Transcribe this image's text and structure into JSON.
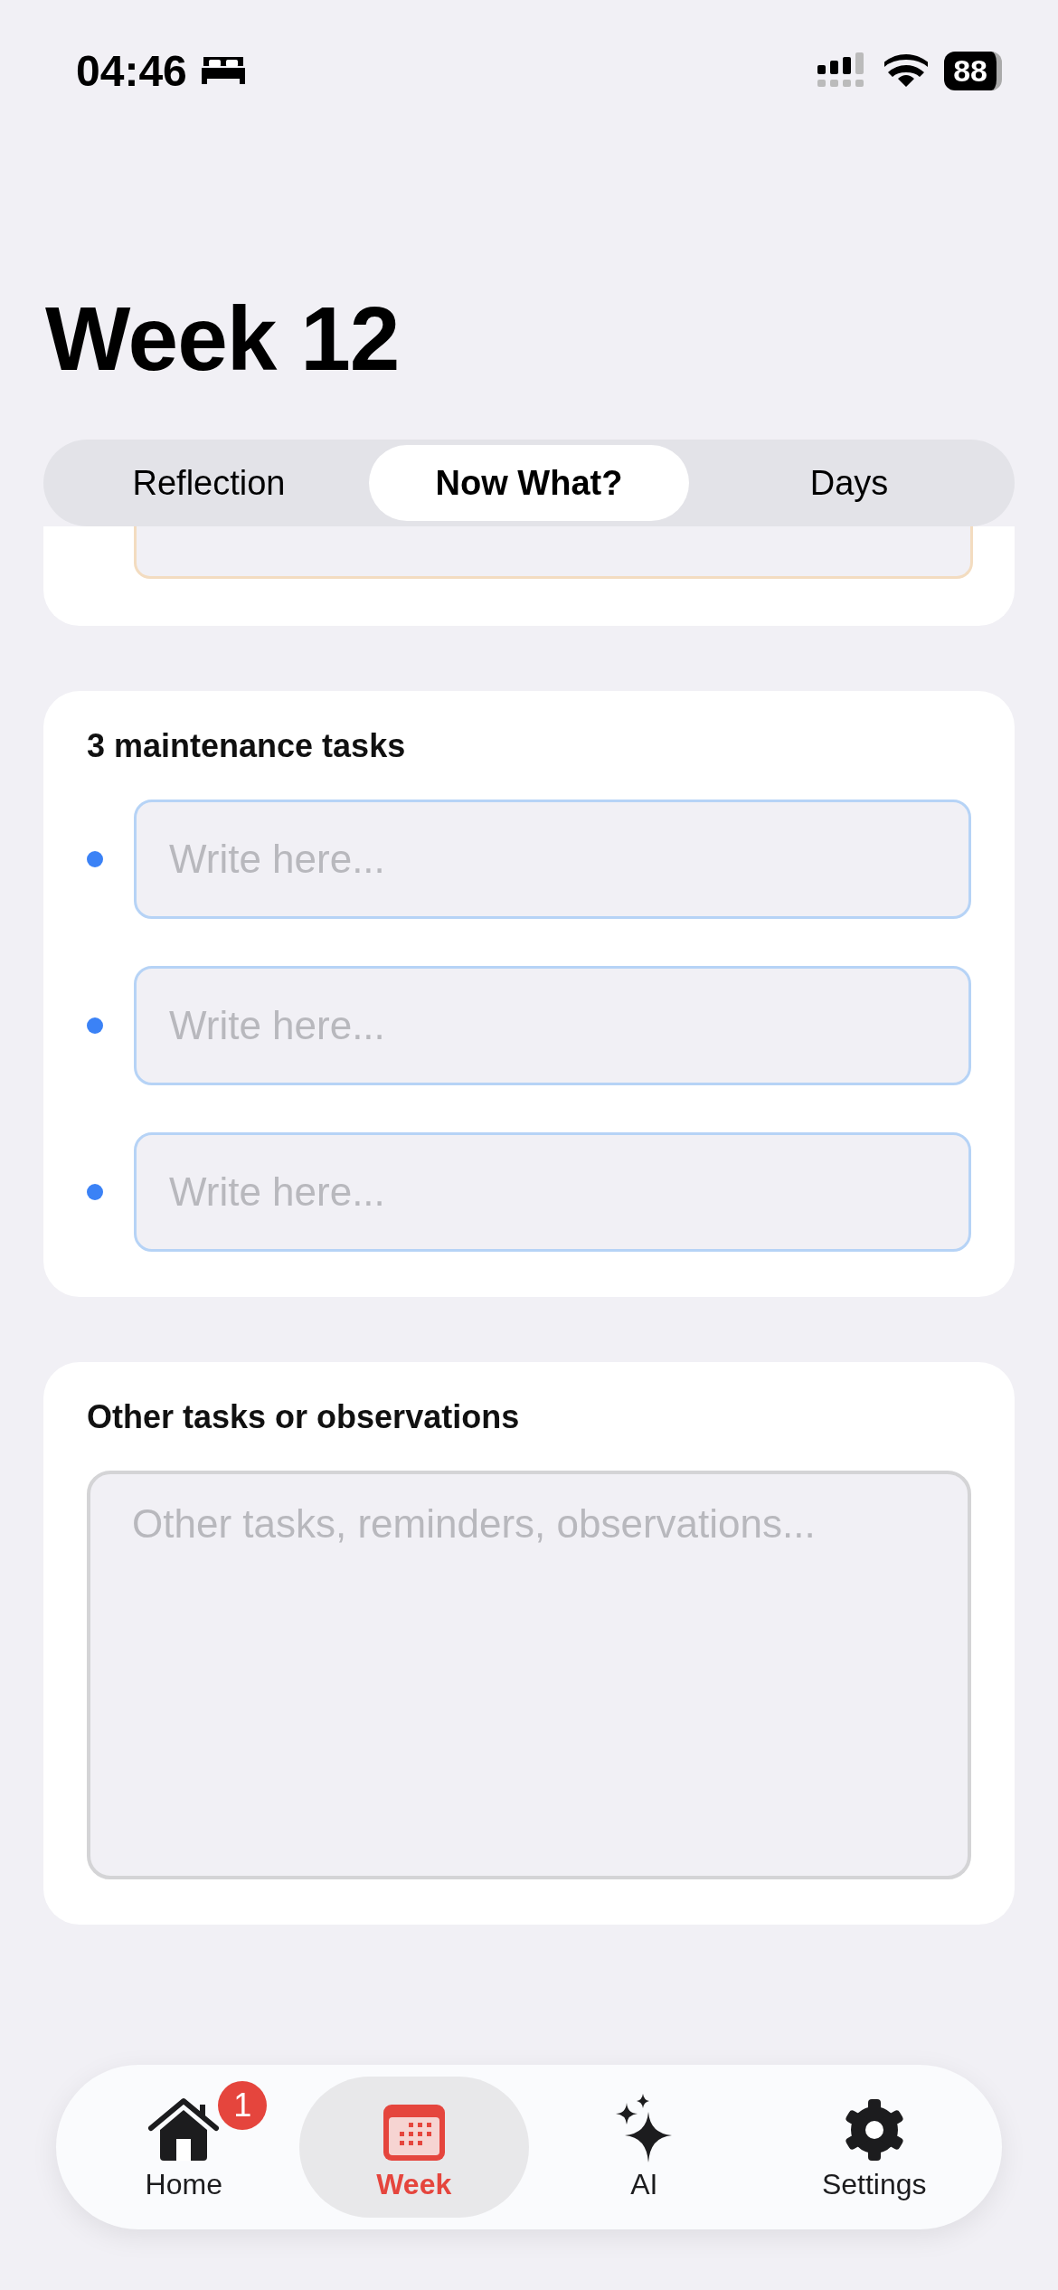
{
  "status_bar": {
    "time": "04:46",
    "battery": "88"
  },
  "title": "Week 12",
  "segments": [
    {
      "label": "Reflection",
      "selected": false
    },
    {
      "label": "Now What?",
      "selected": true
    },
    {
      "label": "Days",
      "selected": false
    }
  ],
  "sections": [
    {
      "heading": "3 maintenance tasks",
      "kind": "list",
      "fields": [
        {
          "placeholder": "Write here..."
        },
        {
          "placeholder": "Write here..."
        },
        {
          "placeholder": "Write here..."
        }
      ]
    },
    {
      "heading": "Other tasks or observations",
      "kind": "note",
      "placeholder": "Other tasks, reminders, observations..."
    }
  ],
  "tab_bar": [
    {
      "label": "Home",
      "badge": "1",
      "selected": false
    },
    {
      "label": "Week",
      "selected": true
    },
    {
      "label": "AI",
      "selected": false
    },
    {
      "label": "Settings",
      "selected": false
    }
  ]
}
